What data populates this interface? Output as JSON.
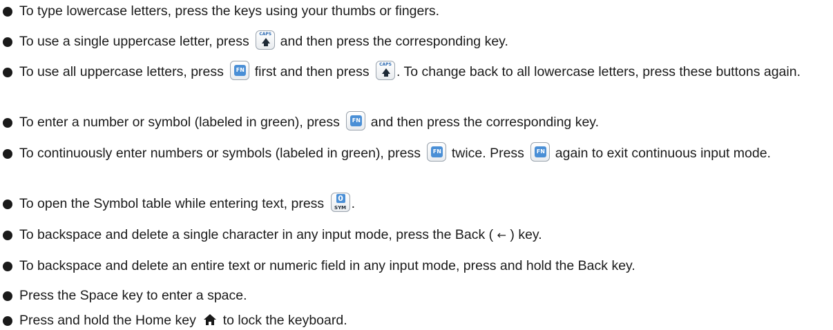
{
  "icons": {
    "bullet": "bullet-dot",
    "caps_key": "caps-key-icon",
    "fn_key": "fn-key-icon",
    "sym_key": "sym-key-icon",
    "home_key": "home-icon",
    "back_arrow": "back-arrow-icon"
  },
  "key_labels": {
    "caps": "CAPS",
    "fn": "FN",
    "sym_digit": "0",
    "sym": "SYM",
    "back_arrow": "←"
  },
  "items": [
    {
      "text": "To type lowercase letters, press the keys using your thumbs or fingers."
    },
    {
      "before": "To use a single uppercase letter, press",
      "after": "and then press the corresponding key."
    },
    {
      "part1": "To use all uppercase letters, press",
      "part2": "first and then press",
      "part3": ". To change back to all lowercase letters, press these buttons again."
    },
    {
      "before": "To enter a number or symbol (labeled in green), press",
      "after": "and then press the corresponding key."
    },
    {
      "part1": "To continuously enter numbers or symbols (labeled in green), press",
      "part2": "twice. Press",
      "part3": "again to exit continuous input mode."
    },
    {
      "before": "To open the Symbol table while entering text, press",
      "after": "."
    },
    {
      "before": "To backspace and delete a single character in any input mode, press the",
      "bold": "Back",
      "after1": "(",
      "after2": ") key."
    },
    {
      "before": "To backspace and delete an entire text or numeric field in any input mode, press and hold the",
      "bold": "Back",
      "after": "key."
    },
    {
      "text": "Press the Space key to enter a space."
    },
    {
      "before": "Press and hold the",
      "bold": "Home",
      "mid": "key",
      "after": "to lock the keyboard."
    }
  ],
  "colors": {
    "text": "#1a1a1a",
    "key_blue": "#4a8fd6"
  }
}
